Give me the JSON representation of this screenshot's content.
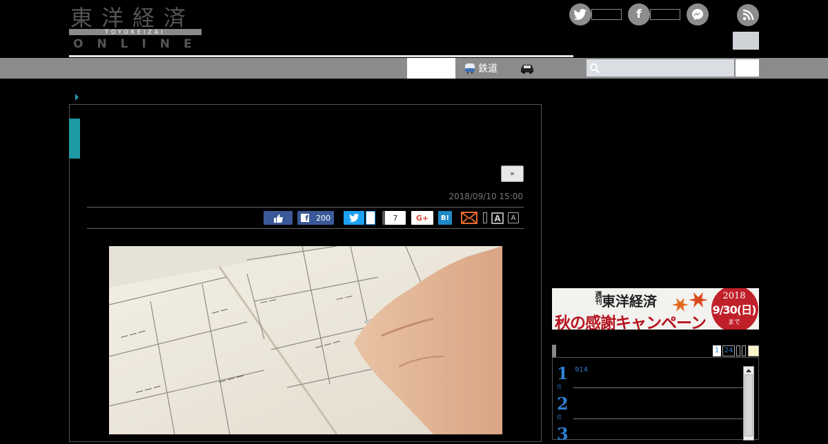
{
  "header": {
    "logo": {
      "kanji": "東洋経済",
      "romaji": "TOYOKEIZAI",
      "online": "ONLINE"
    },
    "social": [
      {
        "icon": "twitter-icon",
        "glyph": "🐦"
      },
      {
        "icon": "facebook-icon",
        "glyph": "f"
      },
      {
        "icon": "messenger-icon",
        "glyph": "~"
      }
    ],
    "rss_icon": "rss-icon"
  },
  "nav": {
    "rail_label": "鉄道",
    "search": {
      "placeholder": "",
      "value": ""
    }
  },
  "article": {
    "more_label": "»",
    "date": "2018/09/10 15:00",
    "share": {
      "like_count": "",
      "facebook_count": "200",
      "twitter_count": "",
      "hatena_other_count": "7",
      "gplus_label": "G+",
      "hatena_label": "B!",
      "font_large": "A",
      "font_small": "A"
    }
  },
  "sidebar": {
    "banner": {
      "magazine": "週刊",
      "brand": "東洋経済",
      "campaign": "秋の感謝キャンペーン",
      "year": "2018",
      "deadline": "9/30(日)",
      "until": "まで"
    },
    "ranking_tabs": [
      "1",
      "24"
    ],
    "ranking": [
      {
        "rank": "1",
        "text": "914"
      },
      {
        "rank": "2",
        "text": ""
      },
      {
        "rank": "3",
        "text": ""
      }
    ]
  },
  "colors": {
    "accent_teal": "#1e9aa2",
    "rank_blue": "#2f7fd1",
    "nav_gray": "#8b8b8b"
  }
}
